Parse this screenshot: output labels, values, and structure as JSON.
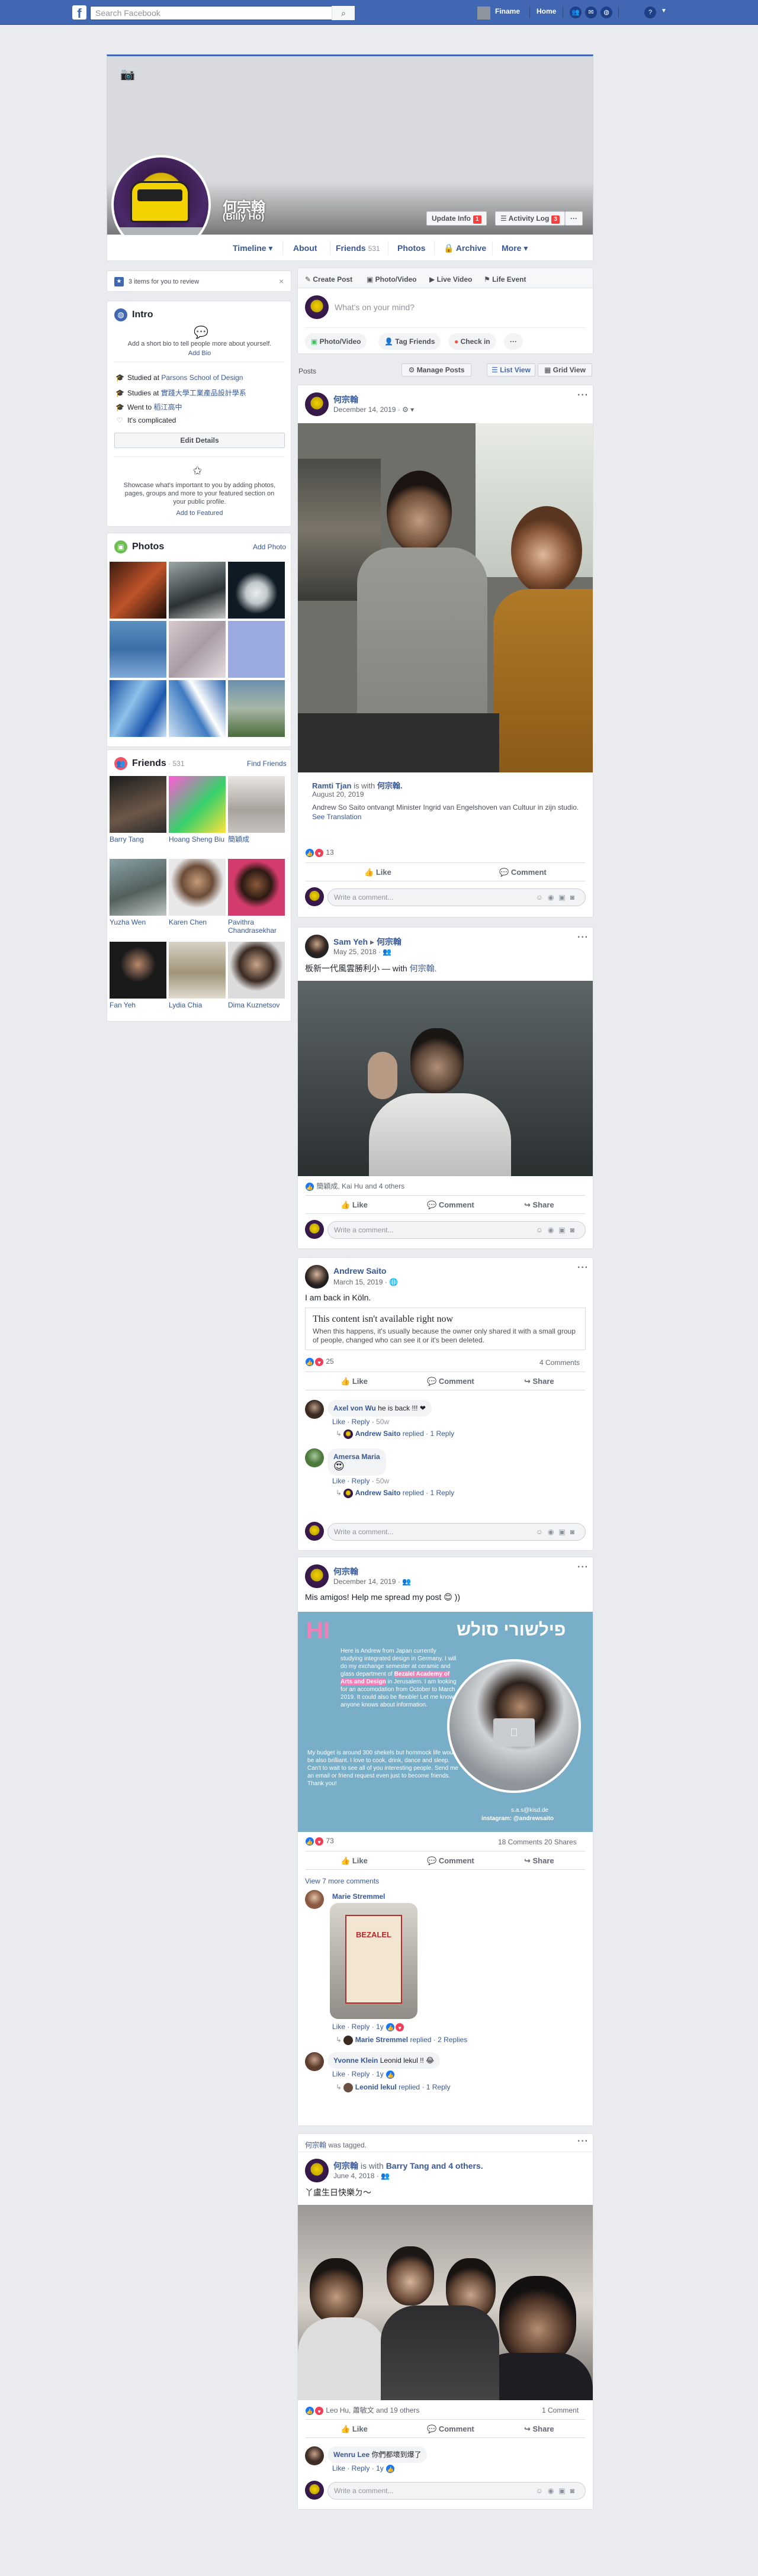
{
  "topbar": {
    "logo": "f",
    "search_placeholder": "Search Facebook",
    "nav": [
      "Finame",
      "Home"
    ],
    "help": "?"
  },
  "profile": {
    "name": "何宗翰",
    "alt_name": "(Billy Ho)",
    "update_info": "Update Info",
    "update_badge": "1",
    "activity_log": "Activity Log",
    "activity_badge": "3",
    "more_btn": "···"
  },
  "tabs": [
    {
      "label": "Timeline ▾"
    },
    {
      "label": "About"
    },
    {
      "label": "Friends",
      "count": "531"
    },
    {
      "label": "Photos"
    },
    {
      "label": "Archive"
    },
    {
      "label": "More ▾"
    }
  ],
  "review": {
    "text": "3 items for you to review"
  },
  "intro": {
    "title": "Intro",
    "bio_prompt": "Add a short bio to tell people more about yourself.",
    "add_bio": "Add Bio",
    "lines": [
      {
        "prefix": "Studied at ",
        "link": "Parsons School of Design"
      },
      {
        "prefix": "Studies at ",
        "link": "實踐大學工業產品設計學系"
      },
      {
        "prefix": "Went to ",
        "link": "稻江高中"
      },
      {
        "prefix": "It's complicated",
        "link": ""
      }
    ],
    "edit_details": "Edit Details",
    "featured_text": "Showcase what's important to you by adding photos, pages, groups and more to your featured section on your public profile.",
    "add_featured": "Add to Featured"
  },
  "photos": {
    "title": "Photos",
    "add": "Add Photo"
  },
  "friends": {
    "title": "Friends",
    "count": "531",
    "find": "Find Friends",
    "list": [
      "Barry Tang",
      "Hoang Sheng Biu",
      "簡穎成",
      "Yuzha Wen",
      "Karen Chen",
      "Pavithra Chandrasekhar",
      "Fan Yeh",
      "Lydia Chia",
      "Dima Kuznetsov"
    ]
  },
  "composer": {
    "tabs": [
      "Create Post",
      "Photo/Video",
      "Live Video",
      "Life Event"
    ],
    "placeholder": "What's on your mind?",
    "pills": [
      "Photo/Video",
      "Tag Friends",
      "Check in",
      "···"
    ]
  },
  "posts_header": {
    "label": "Posts",
    "manage": "Manage Posts",
    "list_view": "List View",
    "grid_view": "Grid View"
  },
  "actions": {
    "like": "Like",
    "comment": "Comment",
    "share": "Share",
    "write": "Write a comment..."
  },
  "post1": {
    "author": "何宗翰",
    "date": "December 14, 2019 · ⚙ ▾",
    "tag_name": "Ramti Tjan",
    "tag_mid": " is with ",
    "tag_other": "何宗翰.",
    "tag_date": "August 20, 2019",
    "tag_text": "Andrew So Saito ontvangt Minister Ingrid van Engelshoven van Cultuur in zijn studio.",
    "see_translation": "See Translation",
    "reactions": "13"
  },
  "post2": {
    "author": "Sam Yeh",
    "tag_mid": " ▸ ",
    "tag_other": "何宗翰",
    "date": "May 25, 2018 · 👥",
    "text_pre": "板新一代風雲勝利小 — with ",
    "text_link": "何宗翰.",
    "reactions": "簡穎成, Kai Hu and 4 others"
  },
  "post3": {
    "author": "Andrew Saito",
    "date": "March 15, 2019 · 🌐",
    "text": "I am back in Köln.",
    "unavailable_title": "This content isn't available right now",
    "unavailable_text": "When this happens, it's usually because the owner only shared it with a small group of people, changed who can see it or it's been deleted.",
    "reactions": "25",
    "comments_count": "4 Comments",
    "c1_author": "Axel von Wu",
    "c1_text": "he is back !!! ❤",
    "c1_meta_a": "Like · Reply · ",
    "c1_meta_b": "50w",
    "c1_reply_name": "Andrew Saito",
    "c1_reply_text": " replied · 1 Reply",
    "c2_author": "Amersa Maria",
    "c2_text": "😍",
    "c2_meta_a": "Like · Reply · ",
    "c2_meta_b": "50w",
    "c2_reply_name": "Andrew Saito",
    "c2_reply_text": " replied · 1 Reply"
  },
  "post4": {
    "author": "何宗翰",
    "date": "December 14, 2019 · 👥",
    "text": "Mis amigos! Help me spread my post 😊 ))",
    "flyer_hi": "HI",
    "flyer_title": "פילשורי סולש",
    "flyer_body1": "Here is Andrew from Japan currently studying integrated design in Germany. I will do my exchange semester at ceramic and glass department of ",
    "flyer_bold": "Bezalel Academy of Arts and Design",
    "flyer_body2": " in Jerusalem. I am looking for an accomodation from October to March 2019. It could also be flexible! Let me know if anyone knows about information.",
    "flyer_body3": "My budget is around 300 shekels but hommock life would be also brilliant. I love to cook, drink, dance and sleep. Can't to wait to see all of you interesting people. Send me an email or friend request even just to become friends. Thank you!",
    "flyer_email": "s.a.s@kisd.de",
    "flyer_ig": "instagram: @andrewsaito",
    "reactions": "73",
    "counts": "18 Comments  20 Shares",
    "view_more": "View 7 more comments",
    "c1_author": "Marie Stremmel",
    "c1_image_text": "BEZALEL",
    "c1_meta": "Like · Reply · 1y",
    "c1_reply_name": "Marie Stremmel",
    "c1_reply_text": " replied · 2 Replies",
    "c2_author": "Yvonne Klein",
    "c2_text": "Leonid lekul !! 😂",
    "c2_meta": "Like · Reply · 1y",
    "c2_reply_name": "Leonid lekul",
    "c2_reply_text": " replied · 1 Reply"
  },
  "post5": {
    "tagged_name": "何宗翰",
    "tagged_text": " was tagged.",
    "author": "何宗翰",
    "with_text": " is with ",
    "with_link": "Barry Tang and 4 others.",
    "date": "June 4, 2018 · 👥",
    "text": "丫盧生日快樂ㄉ～",
    "reactions": "Leo Hu, 蕭敏文 and 19 others",
    "comments_count": "1 Comment",
    "c1_author": "Wenru Lee",
    "c1_text": "你們都壞到爆了",
    "c1_meta": "Like · Reply · 1y"
  },
  "colors": {
    "fb_blue": "#4267b2",
    "link": "#365899",
    "bg": "#e9ebee"
  }
}
